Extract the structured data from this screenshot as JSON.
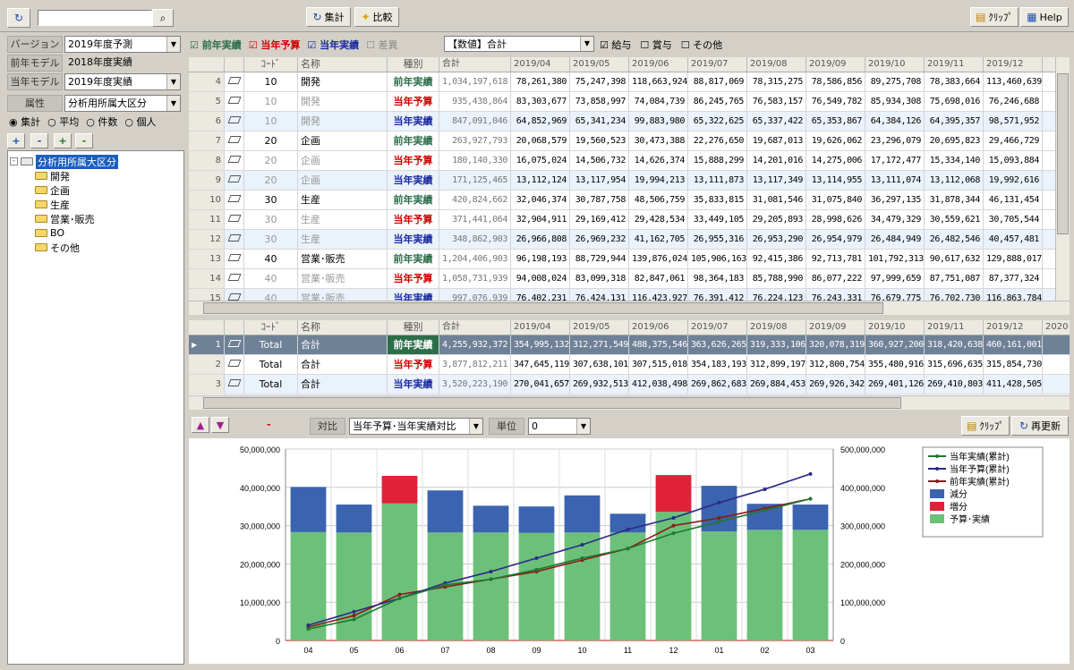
{
  "toolbar": {
    "search_value": "",
    "aggregate": "集計",
    "compare": "比較",
    "clip": "ｸﾘｯﾌﾟ",
    "help": "Help"
  },
  "left": {
    "version_label": "バージョン",
    "version_value": "2019年度予測",
    "prev_model_label": "前年モデル",
    "prev_model_value": "2018年度実績",
    "cur_model_label": "当年モデル",
    "cur_model_value": "2019年度実績",
    "attr_label": "属性",
    "attr_value": "分析用所属大区分",
    "radios": [
      "集計",
      "平均",
      "件数",
      "個人"
    ],
    "buttons": [
      "+",
      "-",
      "+",
      "-"
    ],
    "tree_root": "分析用所属大区分",
    "tree_items": [
      "開発",
      "企画",
      "生産",
      "営業･販売",
      "BO",
      "その他"
    ]
  },
  "filters": {
    "prev_actual": "前年実績",
    "cur_plan": "当年予算",
    "cur_actual": "当年実績",
    "variance": "差異",
    "amount_select": "【数値】合計",
    "salary": "給与",
    "bonus": "賞与",
    "other": "その他"
  },
  "headers": [
    "ｺｰﾄﾞ",
    "名称",
    "種別",
    "合計",
    "2019/04",
    "2019/05",
    "2019/06",
    "2019/07",
    "2019/08",
    "2019/09",
    "2019/10",
    "2019/11",
    "2019/12"
  ],
  "headers_total": [
    "ｺｰﾄﾞ",
    "名称",
    "種別",
    "合計",
    "2019/04",
    "2019/05",
    "2019/06",
    "2019/07",
    "2019/08",
    "2019/09",
    "2019/10",
    "2019/11",
    "2019/12",
    "2020"
  ],
  "rows": [
    {
      "n": "4",
      "code": "10",
      "name": "開発",
      "kind": "前年実績",
      "total": "1,034,197,618",
      "m": [
        "78,261,380",
        "75,247,398",
        "118,663,924",
        "88,817,069",
        "78,315,275",
        "78,586,856",
        "89,275,708",
        "78,383,664",
        "113,460,639"
      ]
    },
    {
      "n": "5",
      "code": "10",
      "name": "開発",
      "kind": "当年予算",
      "total": "935,438,864",
      "m": [
        "83,303,677",
        "73,858,997",
        "74,084,739",
        "86,245,765",
        "76,583,157",
        "76,549,782",
        "85,934,308",
        "75,698,016",
        "76,246,688"
      ]
    },
    {
      "n": "6",
      "code": "10",
      "name": "開発",
      "kind": "当年実績",
      "total": "847,091,046",
      "m": [
        "64,852,969",
        "65,341,234",
        "99,883,980",
        "65,322,625",
        "65,337,422",
        "65,353,867",
        "64,384,126",
        "64,395,357",
        "98,571,952"
      ]
    },
    {
      "n": "7",
      "code": "20",
      "name": "企画",
      "kind": "前年実績",
      "total": "263,927,793",
      "m": [
        "20,068,579",
        "19,560,523",
        "30,473,388",
        "22,276,650",
        "19,687,013",
        "19,626,062",
        "23,296,079",
        "20,695,823",
        "29,466,729"
      ]
    },
    {
      "n": "8",
      "code": "20",
      "name": "企画",
      "kind": "当年予算",
      "total": "180,140,330",
      "m": [
        "16,075,024",
        "14,506,732",
        "14,626,374",
        "15,888,299",
        "14,201,016",
        "14,275,006",
        "17,172,477",
        "15,334,140",
        "15,093,884"
      ]
    },
    {
      "n": "9",
      "code": "20",
      "name": "企画",
      "kind": "当年実績",
      "total": "171,125,465",
      "m": [
        "13,112,124",
        "13,117,954",
        "19,994,213",
        "13,111,873",
        "13,117,349",
        "13,114,955",
        "13,111,074",
        "13,112,068",
        "19,992,616"
      ]
    },
    {
      "n": "10",
      "code": "30",
      "name": "生産",
      "kind": "前年実績",
      "total": "420,824,662",
      "m": [
        "32,046,374",
        "30,787,758",
        "48,506,759",
        "35,833,815",
        "31,081,546",
        "31,075,840",
        "36,297,135",
        "31,878,344",
        "46,131,454"
      ]
    },
    {
      "n": "11",
      "code": "30",
      "name": "生産",
      "kind": "当年予算",
      "total": "371,441,064",
      "m": [
        "32,904,911",
        "29,169,412",
        "29,428,534",
        "33,449,105",
        "29,205,893",
        "28,998,626",
        "34,479,329",
        "30,559,621",
        "30,705,544"
      ]
    },
    {
      "n": "12",
      "code": "30",
      "name": "生産",
      "kind": "当年実績",
      "total": "348,862,903",
      "m": [
        "26,966,808",
        "26,969,232",
        "41,162,705",
        "26,955,316",
        "26,953,290",
        "26,954,979",
        "26,484,949",
        "26,482,546",
        "40,457,481"
      ]
    },
    {
      "n": "13",
      "code": "40",
      "name": "営業･販売",
      "kind": "前年実績",
      "total": "1,204,406,903",
      "m": [
        "96,198,193",
        "88,729,944",
        "139,876,024",
        "105,906,163",
        "92,415,386",
        "92,713,781",
        "101,792,313",
        "90,617,632",
        "129,888,017"
      ]
    },
    {
      "n": "14",
      "code": "40",
      "name": "営業･販売",
      "kind": "当年予算",
      "total": "1,058,731,939",
      "m": [
        "94,008,024",
        "83,099,318",
        "82,847,061",
        "98,364,183",
        "85,788,990",
        "86,077,222",
        "97,999,659",
        "87,751,087",
        "87,377,324"
      ]
    },
    {
      "n": "15",
      "code": "40",
      "name": "営業･販売",
      "kind": "当年実績",
      "total": "997,076,939",
      "m": [
        "76,402,231",
        "76,424,131",
        "116,423,927",
        "76,391,412",
        "76,224,123",
        "76,243,331",
        "76,679,775",
        "76,702,730",
        "116,863,784"
      ]
    }
  ],
  "totals": [
    {
      "n": "1",
      "code": "Total",
      "name": "合計",
      "kind": "前年実績",
      "total": "4,255,932,372",
      "m": [
        "354,995,132",
        "312,271,549",
        "488,375,546",
        "363,626,265",
        "319,333,106",
        "320,078,319",
        "360,927,200",
        "318,420,638",
        "460,161,001",
        "347,0"
      ]
    },
    {
      "n": "2",
      "code": "Total",
      "name": "合計",
      "kind": "当年予算",
      "total": "3,877,812,211",
      "m": [
        "347,645,119",
        "307,638,101",
        "307,515,018",
        "354,183,193",
        "312,899,197",
        "312,800,754",
        "355,480,916",
        "315,696,635",
        "315,854,730",
        "343,0"
      ]
    },
    {
      "n": "3",
      "code": "Total",
      "name": "合計",
      "kind": "当年実績",
      "total": "3,520,223,190",
      "m": [
        "270,041,657",
        "269,932,513",
        "412,038,498",
        "269,862,683",
        "269,884,453",
        "269,926,342",
        "269,401,126",
        "269,410,803",
        "411,428,505",
        "269,4"
      ]
    }
  ],
  "chart_bar": {
    "minus_sign": "-",
    "compare_label": "対比",
    "compare_value": "当年予算･当年実績対比",
    "unit_label": "単位",
    "unit_value": "0",
    "clip": "ｸﾘｯﾌﾟ",
    "refresh": "再更新"
  },
  "chart_data": {
    "type": "bar",
    "categories": [
      "04",
      "05",
      "06",
      "07",
      "08",
      "09",
      "10",
      "11",
      "12",
      "01",
      "02",
      "03"
    ],
    "left_ticks": [
      "50,000,000",
      "40,000,000",
      "30,000,000",
      "20,000,000",
      "10,000,000",
      "0"
    ],
    "right_ticks": [
      "500,000,000",
      "400,000,000",
      "300,000,000",
      "200,000,000",
      "100,000,000",
      "0"
    ],
    "ylim_left": [
      0,
      50000000
    ],
    "ylim_right": [
      0,
      500000000
    ],
    "base": [
      28300000,
      28200000,
      35800000,
      28200000,
      28200000,
      28100000,
      28200000,
      28200000,
      33600000,
      28500000,
      28900000,
      28900000
    ],
    "decrease": [
      11800000,
      7300000,
      0,
      11000000,
      7000000,
      6900000,
      9700000,
      4900000,
      0,
      11900000,
      6800000,
      6600000
    ],
    "increase": [
      0,
      0,
      7200000,
      0,
      0,
      0,
      0,
      0,
      9600000,
      0,
      0,
      0
    ],
    "cum_cur_actual": [
      30000000,
      55000000,
      110000000,
      145000000,
      160000000,
      185000000,
      215000000,
      240000000,
      280000000,
      310000000,
      340000000,
      370000000
    ],
    "cum_cur_plan": [
      40000000,
      75000000,
      110000000,
      150000000,
      180000000,
      215000000,
      250000000,
      290000000,
      320000000,
      360000000,
      395000000,
      435000000
    ],
    "cum_prev_actual": [
      35000000,
      65000000,
      120000000,
      140000000,
      160000000,
      180000000,
      210000000,
      240000000,
      300000000,
      320000000,
      345000000,
      370000000
    ],
    "legend": [
      "当年実績(累計)",
      "当年予算(累計)",
      "前年実績(累計)",
      "減分",
      "増分",
      "予算･実績"
    ],
    "colors": {
      "cum_cur_actual": "#1d7a2e",
      "cum_cur_plan": "#2a2a8a",
      "cum_prev_actual": "#8b1a1a",
      "decrease": "#3b64b0",
      "increase": "#e0213a",
      "base": "#6cc07a"
    }
  }
}
